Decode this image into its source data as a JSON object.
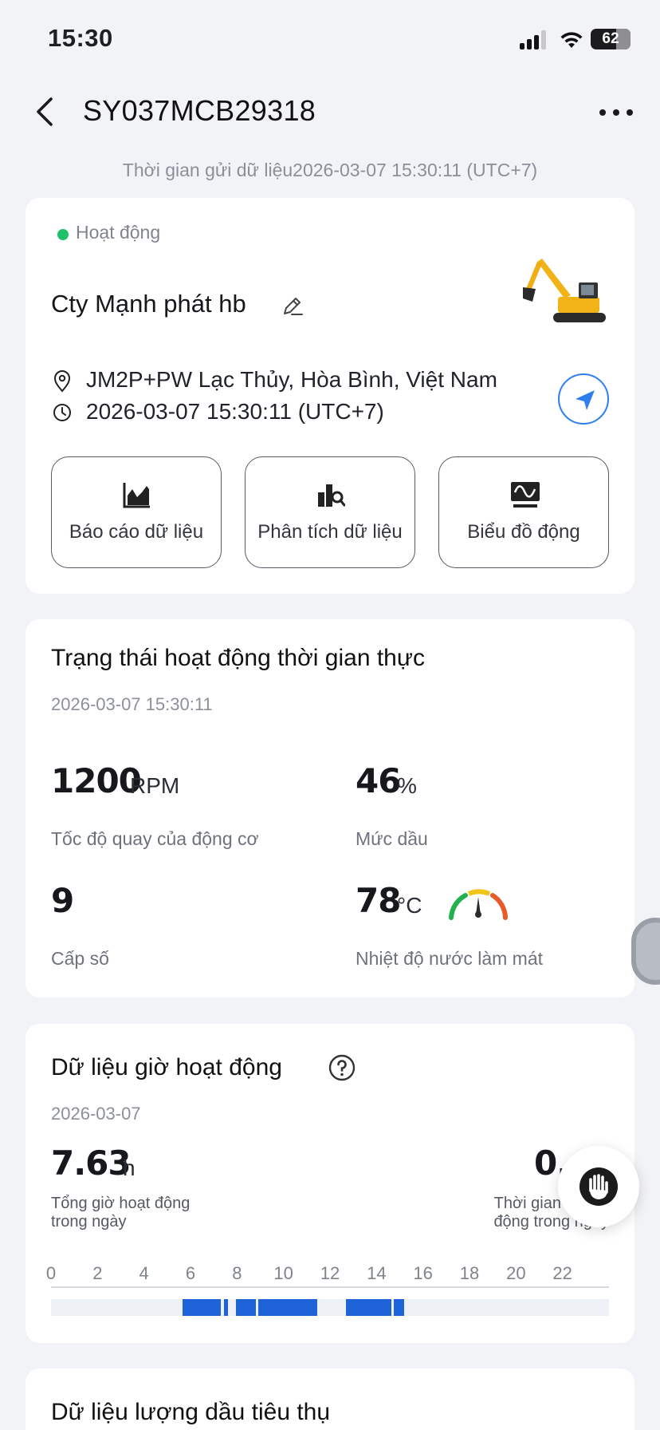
{
  "status_bar": {
    "time": "15:30",
    "battery": "62"
  },
  "header": {
    "title": "SY037MCB29318"
  },
  "sent_time": "Thời gian gửi dữ liệu2026-03-07 15:30:11 (UTC+7)",
  "overview": {
    "status": "Hoạt động",
    "company": "Cty Mạnh phát hb",
    "location": "JM2P+PW Lạc Thủy, Hòa Bình, Việt Nam",
    "timestamp": "2026-03-07 15:30:11 (UTC+7)",
    "actions": [
      {
        "label": "Báo cáo dữ liệu",
        "icon": "area-chart-icon"
      },
      {
        "label": "Phân tích dữ liệu",
        "icon": "analysis-icon"
      },
      {
        "label": "Biểu đồ động",
        "icon": "monitor-wave-icon"
      }
    ]
  },
  "realtime": {
    "title": "Trạng thái hoạt động thời gian thực",
    "date": "2026-03-07 15:30:11",
    "rpm": {
      "value": "1200",
      "unit": "RPM",
      "label": "Tốc độ quay của động cơ"
    },
    "oil": {
      "value": "46",
      "unit": "%",
      "label": "Mức dầu"
    },
    "gear": {
      "value": "9",
      "label": "Cấp số"
    },
    "coolant": {
      "value": "78",
      "unit": "°C",
      "label": "Nhiệt độ nước làm mát"
    }
  },
  "hours": {
    "title": "Dữ liệu giờ hoạt động",
    "date": "2026-03-07",
    "total": {
      "value": "7.63",
      "unit": "h",
      "label_line1": "Tổng giờ hoạt động",
      "label_line2": "trong ngày"
    },
    "idle": {
      "value": "0.",
      "label_line1": "Thời gian không",
      "label_line2": "động trong ngày"
    },
    "ticks": [
      "0",
      "2",
      "4",
      "6",
      "8",
      "10",
      "12",
      "14",
      "16",
      "18",
      "20",
      "22"
    ],
    "segments": [
      {
        "start": 5.65,
        "end": 7.3
      },
      {
        "start": 7.45,
        "end": 7.6
      },
      {
        "start": 7.95,
        "end": 8.8
      },
      {
        "start": 8.9,
        "end": 11.45
      },
      {
        "start": 12.7,
        "end": 14.65
      },
      {
        "start": 14.75,
        "end": 15.2
      }
    ]
  },
  "fuel": {
    "title": "Dữ liệu lượng dầu tiêu thụ"
  }
}
